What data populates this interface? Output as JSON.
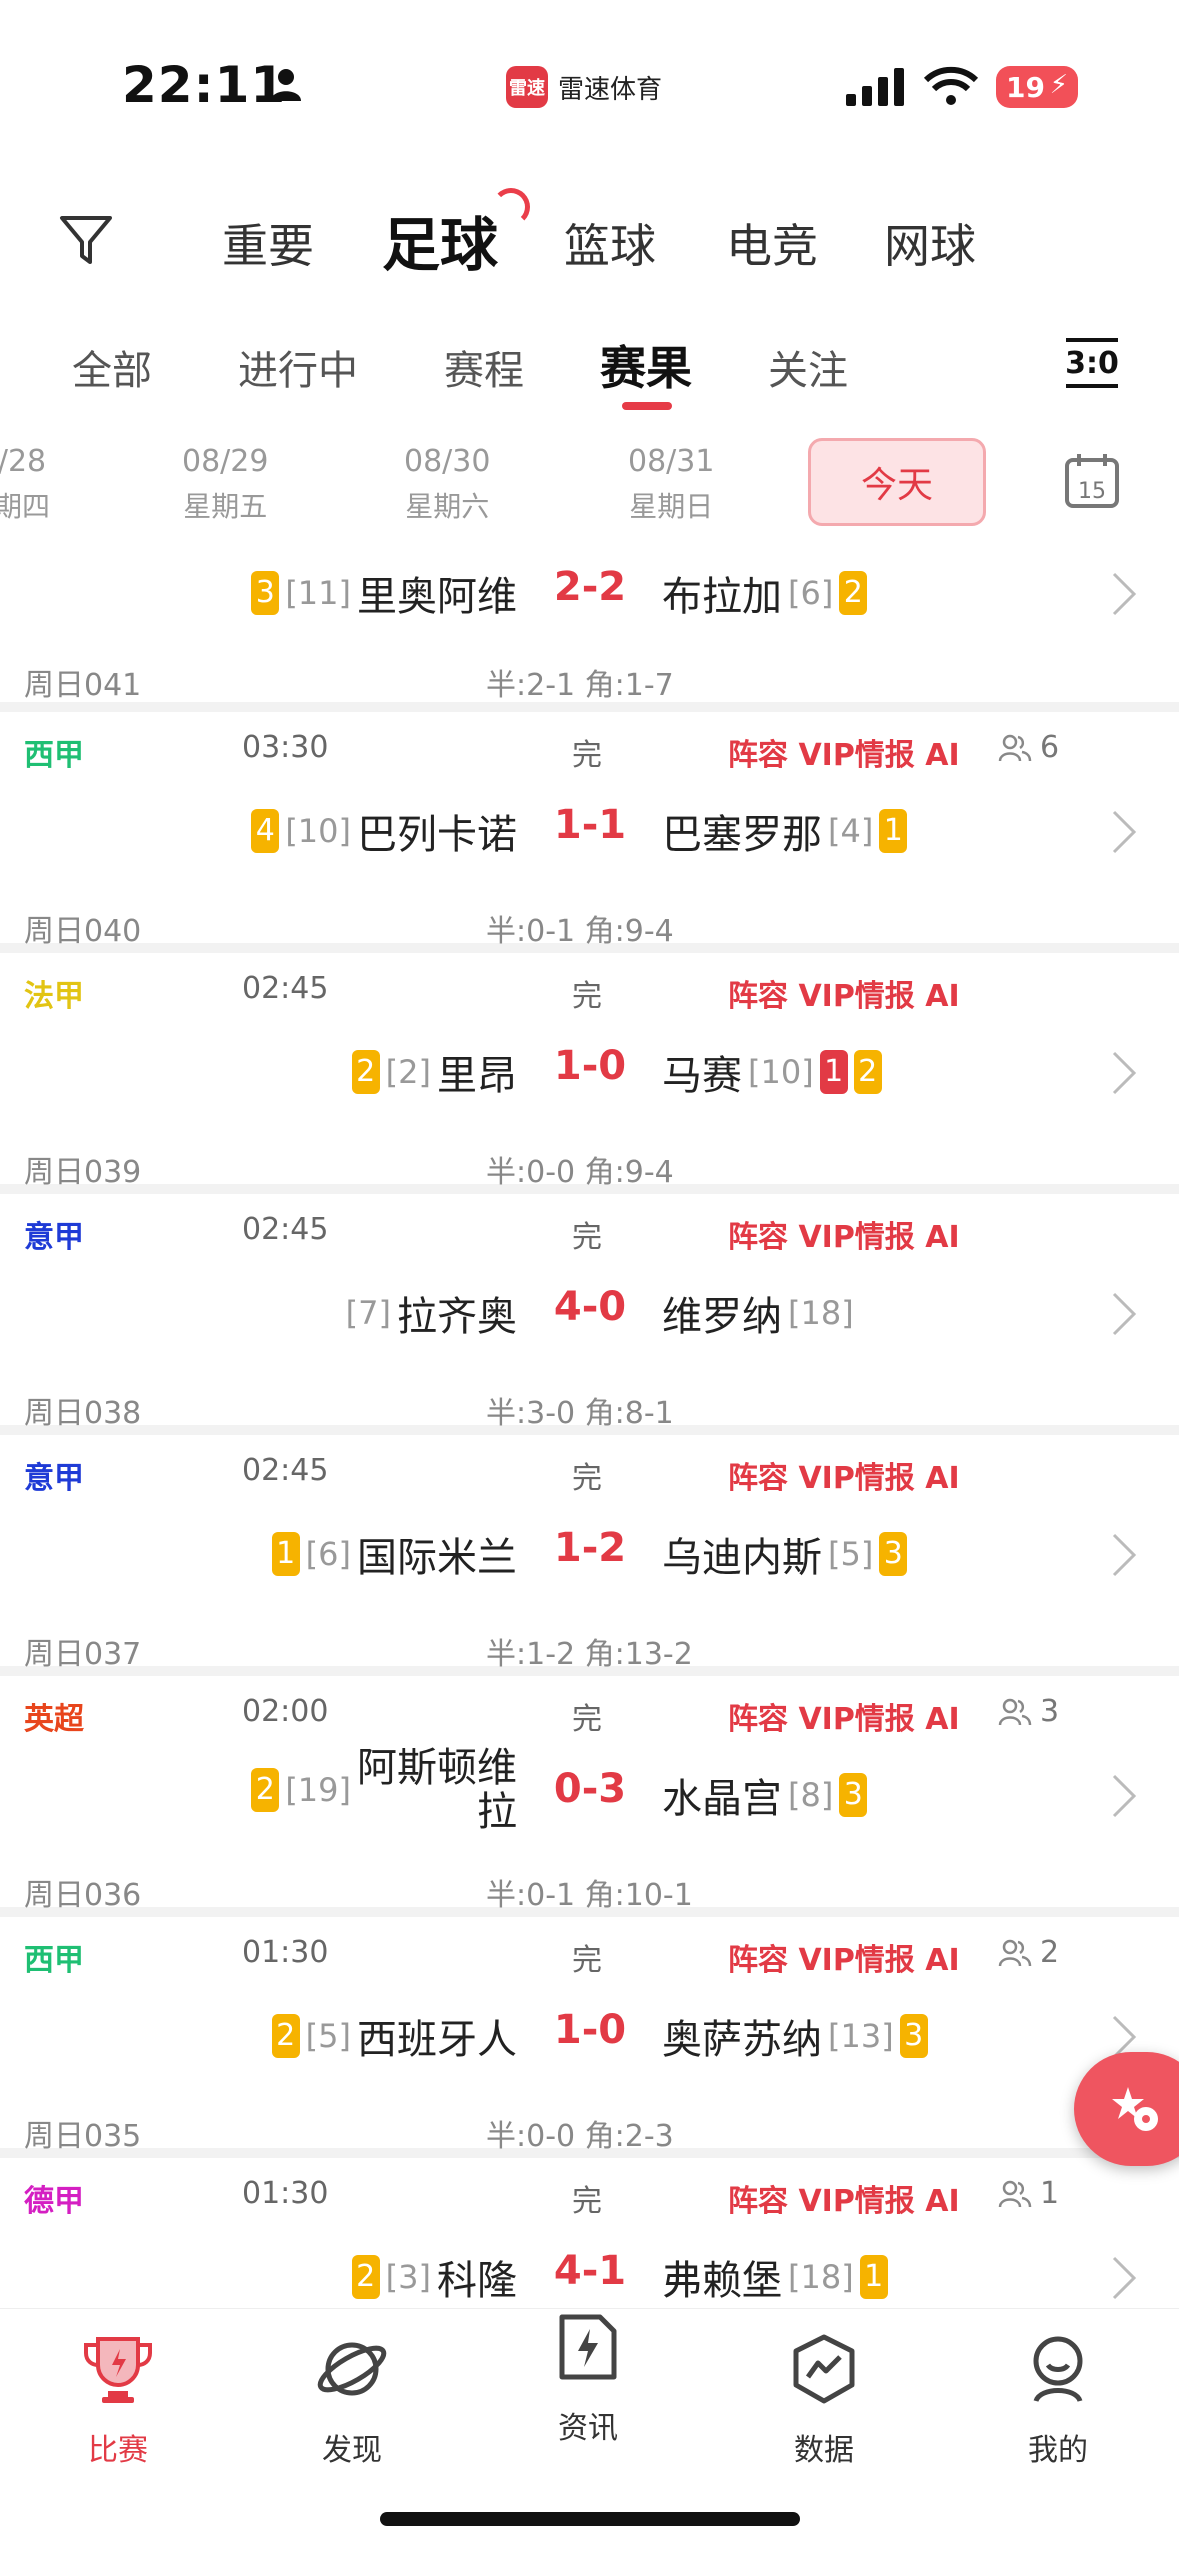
{
  "status_bar": {
    "time": "22:11",
    "app_name": "雷速体育",
    "app_logo_text": "雷速",
    "battery": "19"
  },
  "sport_tabs": [
    "重要",
    "足球",
    "篮球",
    "电竞",
    "网球"
  ],
  "sub_tabs": [
    "全部",
    "进行中",
    "赛程",
    "赛果",
    "关注"
  ],
  "score_toggle": "3:0",
  "dates": [
    {
      "date": "/28",
      "weekday": "期四"
    },
    {
      "date": "08/29",
      "weekday": "星期五"
    },
    {
      "date": "08/30",
      "weekday": "星期六"
    },
    {
      "date": "08/31",
      "weekday": "星期日"
    }
  ],
  "today_label": "今天",
  "calendar_day": "15",
  "matches": [
    {
      "home": {
        "team": "里奥阿维",
        "rank": "[11]",
        "yellow": "3"
      },
      "away": {
        "team": "布拉加",
        "rank": "[6]",
        "yellow": "2"
      },
      "score": "2-2",
      "code": "周日041",
      "half": "半:2-1 角:1-7"
    },
    {
      "league": "西甲",
      "league_color": "#1fbf73",
      "time": "03:30",
      "status": "完",
      "links": "阵容 VIP情报 AI",
      "watch": "6",
      "home": {
        "team": "巴列卡诺",
        "rank": "[10]",
        "yellow": "4"
      },
      "away": {
        "team": "巴塞罗那",
        "rank": "[4]",
        "yellow": "1"
      },
      "score": "1-1",
      "code": "周日040",
      "half": "半:0-1 角:9-4"
    },
    {
      "league": "法甲",
      "league_color": "#e2c413",
      "time": "02:45",
      "status": "完",
      "links": "阵容 VIP情报 AI",
      "home": {
        "team": "里昂",
        "rank": "[2]",
        "yellow": "2"
      },
      "away": {
        "team": "马赛",
        "rank": "[10]",
        "red": "1",
        "yellow": "2"
      },
      "score": "1-0",
      "code": "周日039",
      "half": "半:0-0 角:9-4"
    },
    {
      "league": "意甲",
      "league_color": "#1f3bd6",
      "time": "02:45",
      "status": "完",
      "links": "阵容 VIP情报 AI",
      "home": {
        "team": "拉齐奥",
        "rank": "[7]"
      },
      "away": {
        "team": "维罗纳",
        "rank": "[18]"
      },
      "score": "4-0",
      "code": "周日038",
      "half": "半:3-0 角:8-1"
    },
    {
      "league": "意甲",
      "league_color": "#1f3bd6",
      "time": "02:45",
      "status": "完",
      "links": "阵容 VIP情报 AI",
      "home": {
        "team": "国际米兰",
        "rank": "[6]",
        "yellow": "1"
      },
      "away": {
        "team": "乌迪内斯",
        "rank": "[5]",
        "yellow": "3"
      },
      "score": "1-2",
      "code": "周日037",
      "half": "半:1-2 角:13-2"
    },
    {
      "league": "英超",
      "league_color": "#e8451c",
      "time": "02:00",
      "status": "完",
      "links": "阵容 VIP情报 AI",
      "watch": "3",
      "home": {
        "team_line1": "阿斯顿维",
        "team_line2": "拉",
        "rank": "[19]",
        "yellow": "2"
      },
      "away": {
        "team": "水晶宫",
        "rank": "[8]",
        "yellow": "3"
      },
      "score": "0-3",
      "code": "周日036",
      "half": "半:0-1 角:10-1"
    },
    {
      "league": "西甲",
      "league_color": "#1fbf73",
      "time": "01:30",
      "status": "完",
      "links": "阵容 VIP情报 AI",
      "watch": "2",
      "home": {
        "team": "西班牙人",
        "rank": "[5]",
        "yellow": "2"
      },
      "away": {
        "team": "奥萨苏纳",
        "rank": "[13]",
        "yellow": "3"
      },
      "score": "1-0",
      "code": "周日035",
      "half": "半:0-0 角:2-3"
    },
    {
      "league": "德甲",
      "league_color": "#d41fc2",
      "time": "01:30",
      "status": "完",
      "links": "阵容 VIP情报 AI",
      "watch": "1",
      "home": {
        "team": "科隆",
        "rank": "[3]",
        "yellow": "2"
      },
      "away": {
        "team": "弗赖堡",
        "rank": "[18]",
        "yellow": "1"
      },
      "score": "4-1"
    }
  ],
  "bottom_nav": [
    "比赛",
    "发现",
    "资讯",
    "数据",
    "我的"
  ],
  "colors": {
    "accent": "#e23a45",
    "yellow_card": "#f6b300",
    "red_card": "#e23a45"
  }
}
